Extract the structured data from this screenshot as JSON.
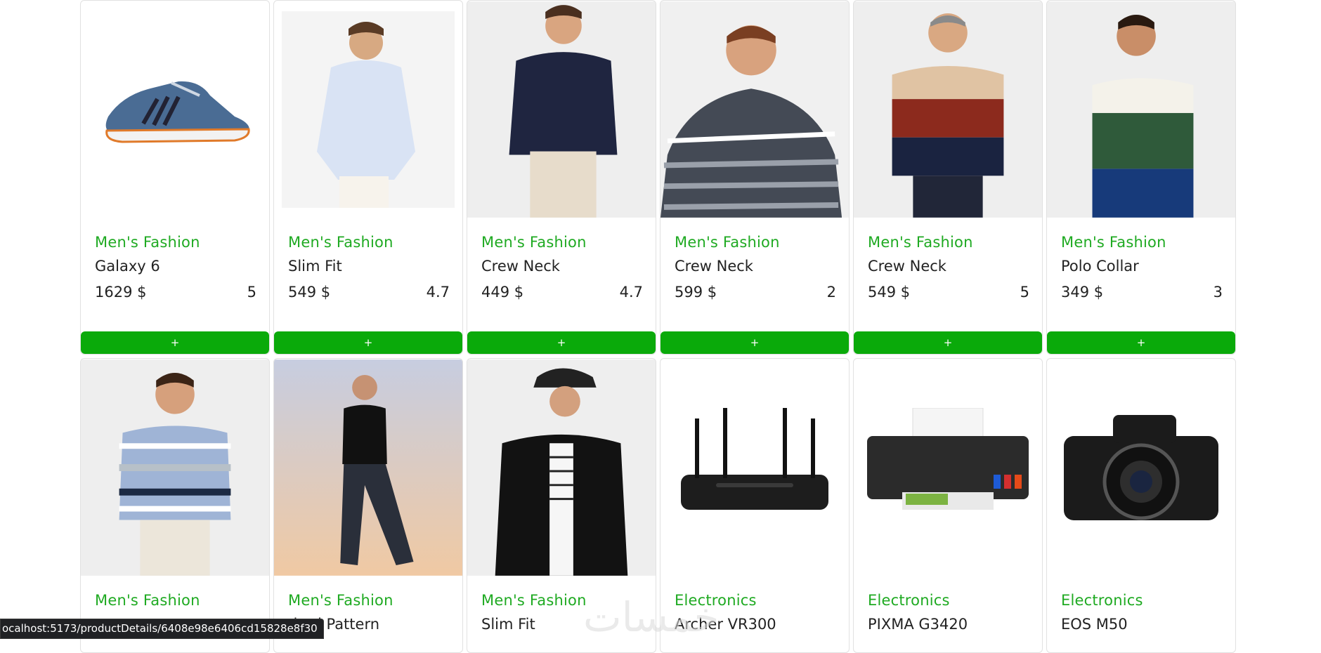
{
  "products_row1": [
    {
      "category": "Men's Fashion",
      "title": "Galaxy 6",
      "price": "1629 $",
      "rating": "5",
      "add_label": "+",
      "image": "sneaker-image"
    },
    {
      "category": "Men's Fashion",
      "title": "Slim Fit",
      "price": "549 $",
      "rating": "4.7",
      "add_label": "+",
      "image": "shirt-model-image"
    },
    {
      "category": "Men's Fashion",
      "title": "Crew Neck",
      "price": "449 $",
      "rating": "4.7",
      "add_label": "+",
      "image": "navy-sweater-image"
    },
    {
      "category": "Men's Fashion",
      "title": "Crew Neck",
      "price": "599 $",
      "rating": "2",
      "add_label": "+",
      "image": "striped-sweater-image"
    },
    {
      "category": "Men's Fashion",
      "title": "Crew Neck",
      "price": "549 $",
      "rating": "5",
      "add_label": "+",
      "image": "colorblock-sweater-image"
    },
    {
      "category": "Men's Fashion",
      "title": "Polo Collar",
      "price": "349 $",
      "rating": "3",
      "add_label": "+",
      "image": "polo-image"
    }
  ],
  "products_row2": [
    {
      "category": "Men's Fashion",
      "title": "",
      "image": "blue-striped-sweater-image"
    },
    {
      "category": "Men's Fashion",
      "title": "dard Pattern",
      "image": "plaid-pajama-image"
    },
    {
      "category": "Men's Fashion",
      "title": "Slim Fit",
      "image": "leather-jacket-image"
    },
    {
      "category": "Electronics",
      "title": "Archer VR300",
      "image": "router-image"
    },
    {
      "category": "Electronics",
      "title": "PIXMA G3420",
      "image": "printer-image"
    },
    {
      "category": "Electronics",
      "title": "EOS M50",
      "image": "camera-image"
    }
  ],
  "status_bar_url": "ocalhost:5173/productDetails/6408e98e6406cd15828e8f30",
  "watermark": "خمسات",
  "colors": {
    "accent": "#1faa22",
    "button": "#0aaa0a"
  }
}
